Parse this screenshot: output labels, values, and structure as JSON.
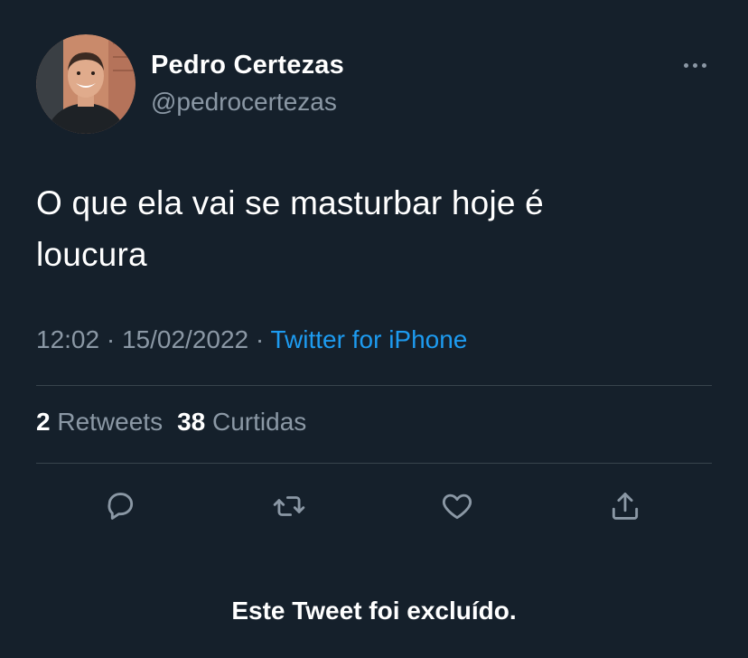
{
  "tweet": {
    "author": {
      "display_name": "Pedro Certezas",
      "handle": "@pedrocertezas"
    },
    "text_line1": "O que ela vai se masturbar hoje é",
    "text_line2": "loucura",
    "time": "12:02",
    "separator": "·",
    "date": "15/02/2022",
    "source": "Twitter for iPhone",
    "retweets_count": "2",
    "retweets_label": "Retweets",
    "likes_count": "38",
    "likes_label": "Curtidas"
  },
  "notice": "Este Tweet foi excluído.",
  "icons": {
    "more": "more-horizontal-icon",
    "reply": "reply-icon",
    "retweet": "retweet-icon",
    "like": "heart-icon",
    "share": "share-icon"
  },
  "colors": {
    "background": "#15202b",
    "secondary_text": "#8b98a5",
    "link": "#1d9bf0",
    "divider": "#38444d"
  }
}
